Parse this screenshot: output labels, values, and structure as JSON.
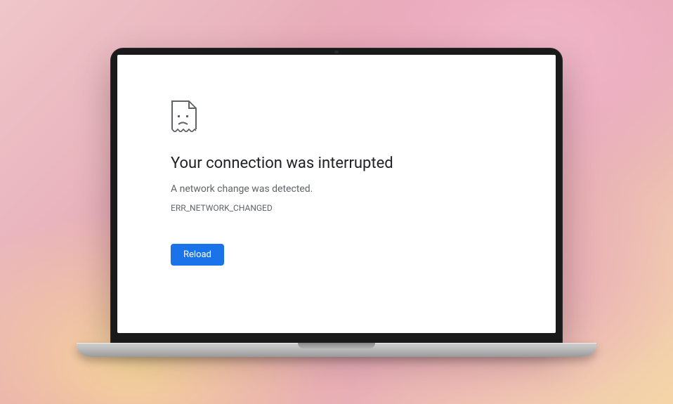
{
  "error": {
    "title": "Your connection was interrupted",
    "subtitle": "A network change was detected.",
    "code": "ERR_NETWORK_CHANGED",
    "reload_label": "Reload"
  }
}
